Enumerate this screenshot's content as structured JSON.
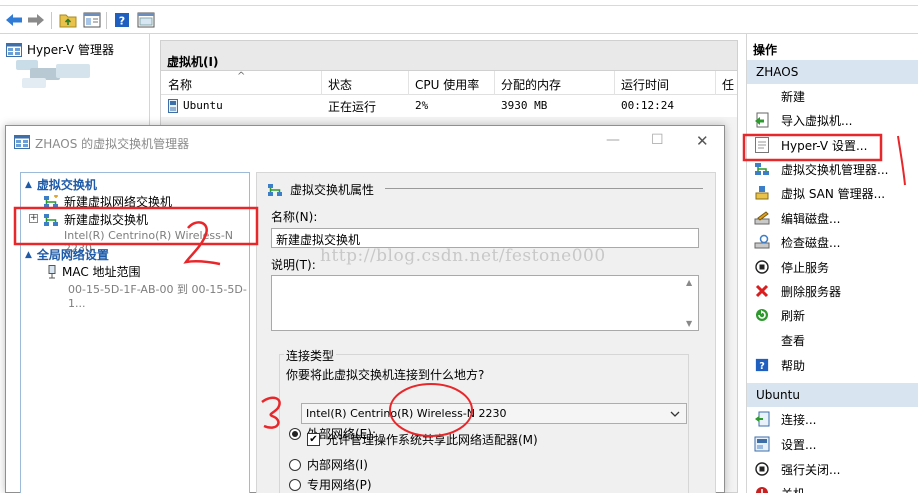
{
  "toolbar": {
    "buttons": [
      "back-arrow-icon",
      "forward-arrow-icon",
      "up-folder-icon",
      "show-hide-tree-icon",
      "help-icon",
      "properties-icon"
    ]
  },
  "tree": {
    "root_label": "Hyper-V 管理器"
  },
  "vm_panel": {
    "title": "虚拟机(I)",
    "columns": [
      "名称",
      "状态",
      "CPU 使用率",
      "分配的内存",
      "运行时间",
      "任"
    ],
    "rows": [
      {
        "name": "Ubuntu",
        "state": "正在运行",
        "cpu": "2%",
        "memory": "3930 MB",
        "uptime": "00:12:24"
      }
    ]
  },
  "actions": {
    "title": "操作",
    "group1": "ZHAOS",
    "group1_items": [
      "新建",
      "导入虚拟机...",
      "Hyper-V 设置...",
      "虚拟交换机管理器...",
      "虚拟 SAN 管理器...",
      "编辑磁盘...",
      "检查磁盘...",
      "停止服务",
      "删除服务器",
      "刷新",
      "查看",
      "帮助"
    ],
    "group2": "Ubuntu",
    "group2_items": [
      "连接...",
      "设置...",
      "强行关闭...",
      "关机..."
    ]
  },
  "dialog": {
    "title": "ZHAOS 的虚拟交换机管理器",
    "nav": {
      "section1": "虚拟交换机",
      "item_new_network": "新建虚拟网络交换机",
      "item_new_switch": "新建虚拟交换机",
      "item_new_switch_sub": "Intel(R) Centrino(R) Wireless-N 2230",
      "section2": "全局网络设置",
      "item_mac": "MAC 地址范围",
      "item_mac_sub": "00-15-5D-1F-AB-00 到 00-15-5D-1..."
    },
    "props": {
      "header": "虚拟交换机属性",
      "name_label": "名称(N):",
      "name_value": "新建虚拟交换机",
      "notes_label": "说明(T):",
      "conn_group": "连接类型",
      "conn_question": "你要将此虚拟交换机连接到什么地方?",
      "radio_external": "外部网络(E):",
      "adapter_value": "Intel(R) Centrino(R) Wireless-N 2230",
      "allow_mgmt": "允许管理操作系统共享此网络适配器(M)",
      "radio_internal": "内部网络(I)",
      "radio_private": "专用网络(P)"
    }
  },
  "watermark": "http://blog.csdn.net/festone000",
  "colors": {
    "accent_blue": "#1e5aa8",
    "group_bg": "#d9e4f1",
    "annotation_red": "#e8272b"
  }
}
